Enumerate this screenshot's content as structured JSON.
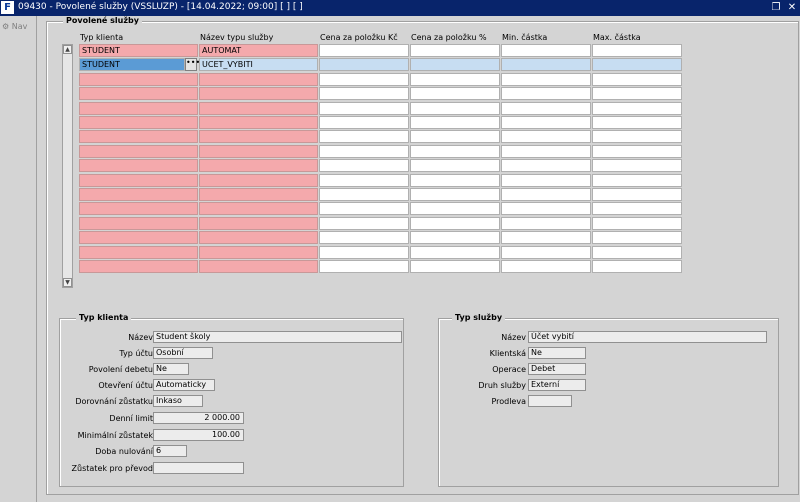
{
  "window": {
    "logo": "F",
    "title": "09430 - Povolené služby (VSSLUZP) - [14.04.2022; 09:00]  [ ]  [ ]",
    "restore_glyph": "❐",
    "close_glyph": "✕"
  },
  "nav": {
    "label": "Nav"
  },
  "grid": {
    "frame_title": "Povolené služby",
    "columns": [
      "Typ klienta",
      "Název typu služby",
      "Cena za položku Kč",
      "Cena za položku %",
      "Min. částka",
      "Max. částka"
    ],
    "rows": [
      [
        "STUDENT",
        "AUTOMAT",
        "",
        "",
        "",
        ""
      ],
      [
        "STUDENT",
        "UCET_VYBITI",
        "",
        "",
        "",
        ""
      ],
      [
        "",
        "",
        "",
        "",
        "",
        ""
      ],
      [
        "",
        "",
        "",
        "",
        "",
        ""
      ],
      [
        "",
        "",
        "",
        "",
        "",
        ""
      ],
      [
        "",
        "",
        "",
        "",
        "",
        ""
      ],
      [
        "",
        "",
        "",
        "",
        "",
        ""
      ],
      [
        "",
        "",
        "",
        "",
        "",
        ""
      ],
      [
        "",
        "",
        "",
        "",
        "",
        ""
      ],
      [
        "",
        "",
        "",
        "",
        "",
        ""
      ],
      [
        "",
        "",
        "",
        "",
        "",
        ""
      ],
      [
        "",
        "",
        "",
        "",
        "",
        ""
      ],
      [
        "",
        "",
        "",
        "",
        "",
        ""
      ],
      [
        "",
        "",
        "",
        "",
        "",
        ""
      ],
      [
        "",
        "",
        "",
        "",
        "",
        ""
      ],
      [
        "",
        "",
        "",
        "",
        "",
        ""
      ]
    ],
    "selected_row_index": 1,
    "ellipsis_label": "•••"
  },
  "typ_klienta": {
    "title": "Typ klienta",
    "fields": [
      {
        "label": "Název",
        "value": "Student školy"
      },
      {
        "label": "Typ účtu",
        "value": "Osobní"
      },
      {
        "label": "Povolení debetu",
        "value": "Ne"
      },
      {
        "label": "Otevření účtu",
        "value": "Automaticky"
      },
      {
        "label": "Dorovnání zůstatku",
        "value": "Inkaso"
      },
      {
        "label": "Denní limit",
        "value": "2 000.00"
      },
      {
        "label": "Minimální zůstatek",
        "value": "100.00"
      },
      {
        "label": "Doba nulování",
        "value": "6"
      },
      {
        "label": "Zůstatek pro převod",
        "value": ""
      }
    ]
  },
  "typ_sluzby": {
    "title": "Typ služby",
    "fields": [
      {
        "label": "Název",
        "value": "Účet vybití"
      },
      {
        "label": "Klientská",
        "value": "Ne"
      },
      {
        "label": "Operace",
        "value": "Debet"
      },
      {
        "label": "Druh služby",
        "value": "Externí"
      },
      {
        "label": "Prodleva",
        "value": ""
      }
    ]
  },
  "colors": {
    "titlebar": "#08246b",
    "required_cell": "#f4a9ac",
    "selected_row": "#c7ddf2",
    "active_cell": "#5b9bd5"
  }
}
